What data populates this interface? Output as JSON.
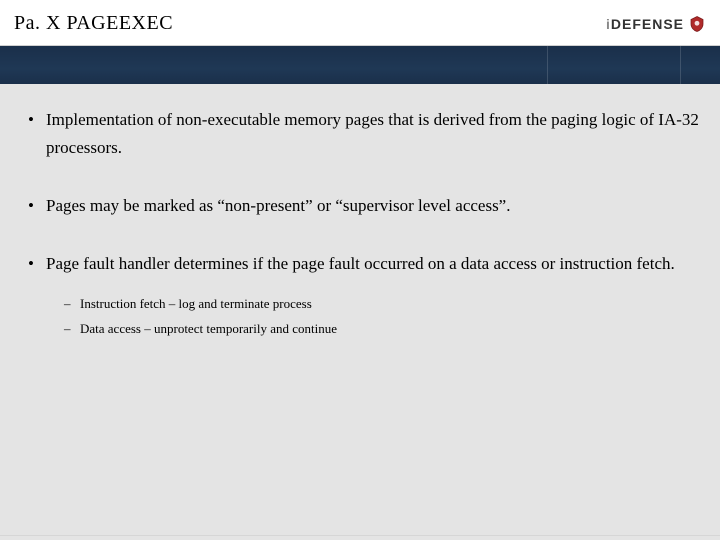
{
  "header": {
    "title": "Pa. X PAGEEXEC",
    "logo_text_prefix": "i",
    "logo_text_rest": "DEFENSE"
  },
  "band": {
    "faint1": "",
    "faint2": ""
  },
  "bullets": [
    {
      "text": "Implementation of non-executable memory pages that is derived from the paging logic of IA-32 processors.",
      "sub": []
    },
    {
      "text": "Pages may be marked as “non-present” or “supervisor level access”.",
      "sub": []
    },
    {
      "text": "Page fault handler determines if the page fault occurred on a data access or instruction fetch.",
      "sub": [
        "Instruction fetch – log and terminate process",
        "Data access – unprotect temporarily and continue"
      ]
    }
  ]
}
